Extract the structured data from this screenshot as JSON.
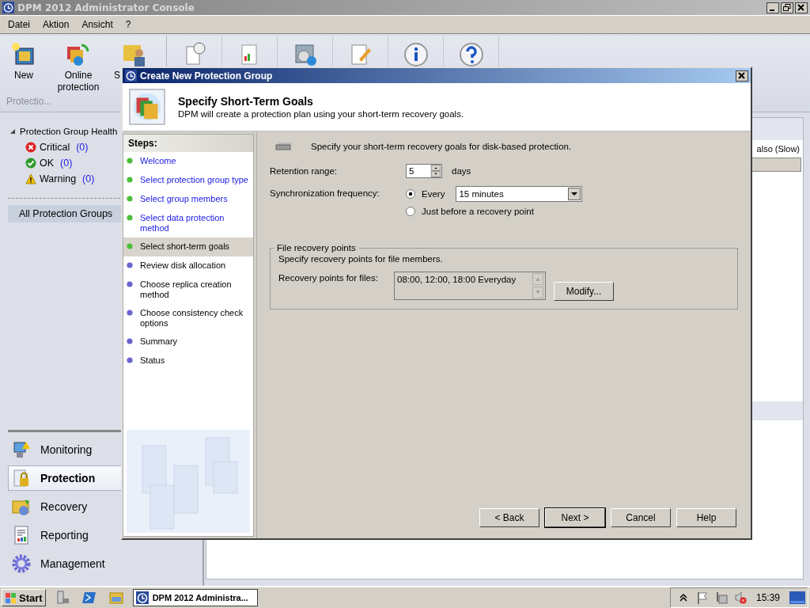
{
  "window": {
    "title": "DPM 2012 Administrator Console"
  },
  "menu": [
    "Datei",
    "Aktion",
    "Ansicht",
    "?"
  ],
  "toolbar": {
    "buttons": [
      {
        "label": "New"
      },
      {
        "label": "Online protection"
      },
      {
        "label": "S"
      }
    ],
    "group_label": "Protectio..."
  },
  "health": {
    "title": "Protection Group Health",
    "expanded": true,
    "children": [
      {
        "label": "Critical",
        "count": "(0)",
        "kind": "critical"
      },
      {
        "label": "OK",
        "count": "(0)",
        "kind": "ok"
      },
      {
        "label": "Warning",
        "count": "(0)",
        "kind": "warning"
      }
    ]
  },
  "groups_item": {
    "label": "All Protection Groups",
    "selected": true
  },
  "navigation": [
    {
      "label": "Monitoring",
      "selected": false
    },
    {
      "label": "Protection",
      "selected": true
    },
    {
      "label": "Recovery",
      "selected": false
    },
    {
      "label": "Reporting",
      "selected": false
    },
    {
      "label": "Management",
      "selected": false
    }
  ],
  "main_pane": {
    "column_text": "also (Slow)"
  },
  "dialog": {
    "title": "Create New Protection Group",
    "heading": "Specify Short-Term Goals",
    "subtitle": "DPM will create a protection plan using your short-term recovery goals.",
    "steps_title": "Steps:",
    "steps": [
      {
        "label": "Welcome",
        "completed": true,
        "selected": false
      },
      {
        "label": "Select protection group type",
        "completed": true,
        "selected": false
      },
      {
        "label": "Select group members",
        "completed": true,
        "selected": false
      },
      {
        "label": "Select data protection method",
        "completed": true,
        "selected": false
      },
      {
        "label": "Select short-term goals",
        "completed": true,
        "selected": true
      },
      {
        "label": "Review disk allocation",
        "completed": false,
        "selected": false
      },
      {
        "label": "Choose replica creation method",
        "completed": false,
        "selected": false
      },
      {
        "label": "Choose consistency check options",
        "completed": false,
        "selected": false
      },
      {
        "label": "Summary",
        "completed": false,
        "selected": false
      },
      {
        "label": "Status",
        "completed": false,
        "selected": false
      }
    ],
    "intro": "Specify your short-term recovery goals for disk-based protection.",
    "retention": {
      "label": "Retention range:",
      "value": "5",
      "unit": "days"
    },
    "sync": {
      "label": "Synchronization frequency:",
      "options": [
        {
          "label": "Every",
          "selected": true
        },
        {
          "label": "Just before a recovery point",
          "selected": false
        }
      ],
      "interval": "15 minutes"
    },
    "file_points": {
      "title": "File recovery points",
      "description": "Specify recovery points for file members.",
      "label": "Recovery points for files:",
      "value": "08:00, 12:00, 18:00 Everyday",
      "button": "Modify..."
    },
    "buttons": [
      {
        "label": "< Back",
        "default": false
      },
      {
        "label": "Next >",
        "default": true
      },
      {
        "label": "Cancel",
        "default": false
      },
      {
        "label": "Help",
        "default": false
      }
    ]
  },
  "taskbar": {
    "start": "Start",
    "task": "DPM 2012 Administra...",
    "clock": "15:39"
  }
}
